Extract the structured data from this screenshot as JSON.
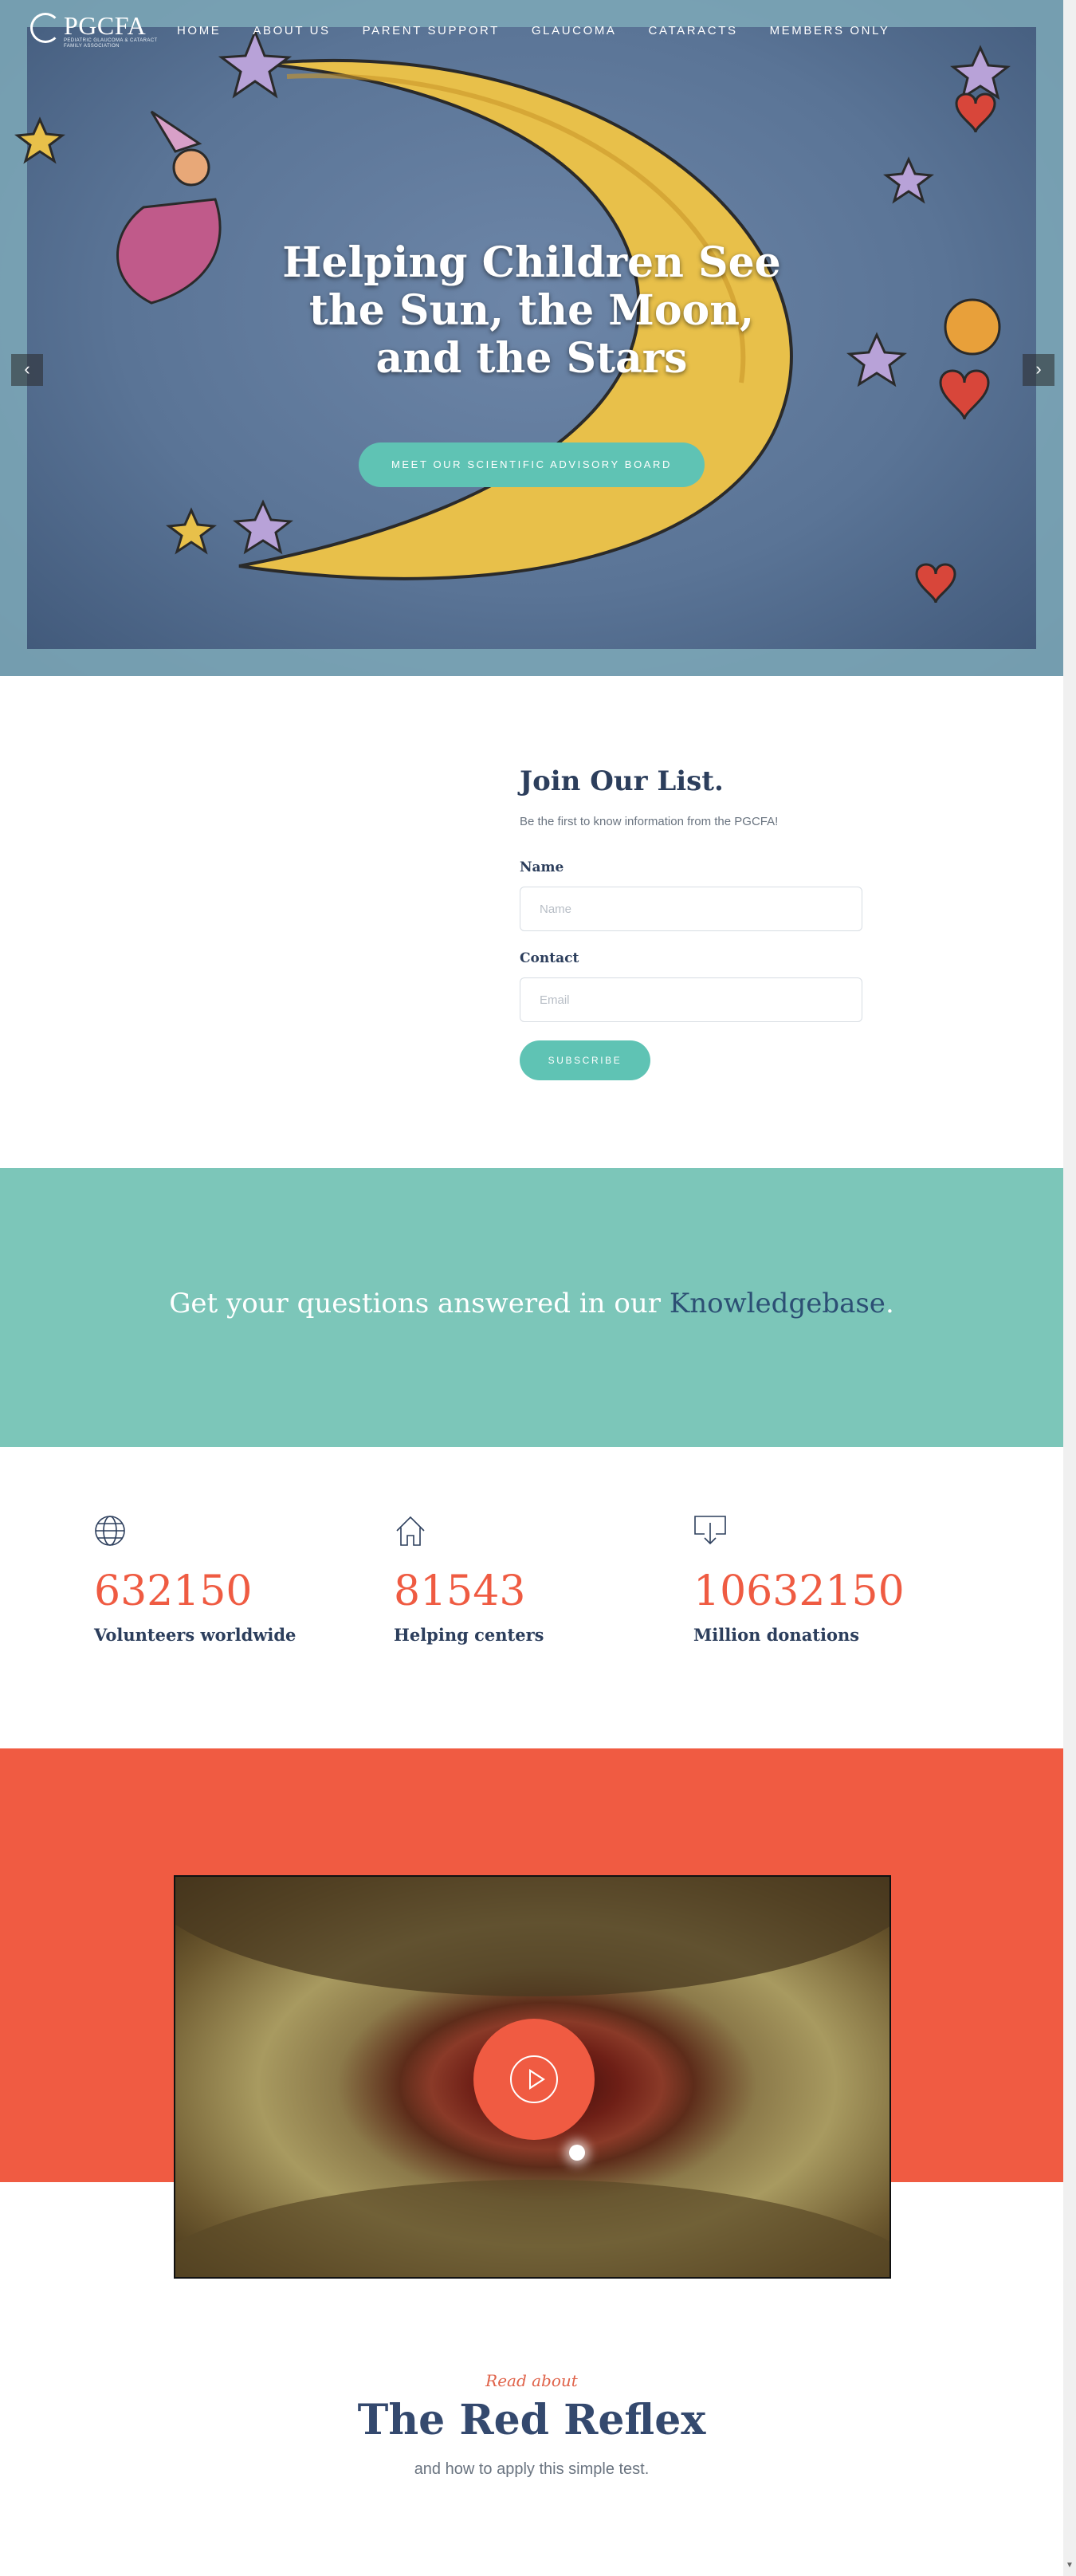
{
  "header": {
    "logo_text": "PGCFA",
    "logo_sub": "PEDIATRIC GLAUCOMA & CATARACT FAMILY ASSOCIATION",
    "nav": [
      "HOME",
      "ABOUT US",
      "PARENT SUPPORT",
      "GLAUCOMA",
      "CATARACTS",
      "MEMBERS ONLY"
    ]
  },
  "hero": {
    "title": "Helping Children See the Sun, the Moon, and the Stars",
    "button": "MEET OUR SCIENTIFIC ADVISORY BOARD",
    "prev_arrow": "‹",
    "next_arrow": "›"
  },
  "join": {
    "title": "Join Our List.",
    "subtitle": "Be the first to know information from the PGCFA!",
    "name_label": "Name",
    "name_placeholder": "Name",
    "contact_label": "Contact",
    "email_placeholder": "Email",
    "button": "SUBSCRIBE"
  },
  "knowledgebase": {
    "text_before": "Get your questions answered in our ",
    "link": "Knowledgebase",
    "text_after": "."
  },
  "stats": [
    {
      "icon": "globe-icon",
      "number": "632150",
      "label": "Volunteers worldwide"
    },
    {
      "icon": "home-icon",
      "number": "81543",
      "label": "Helping centers"
    },
    {
      "icon": "download-icon",
      "number": "10632150",
      "label": "Million donations"
    }
  ],
  "video": {
    "play_icon": "play-icon"
  },
  "read": {
    "pre": "Read about",
    "title": "The Red Reflex",
    "subtitle": "and how to apply this simple test."
  },
  "colors": {
    "teal": "#5fc3b4",
    "teal_band": "#7cc6b9",
    "coral": "#f05b42",
    "navy": "#2c3e5c"
  }
}
